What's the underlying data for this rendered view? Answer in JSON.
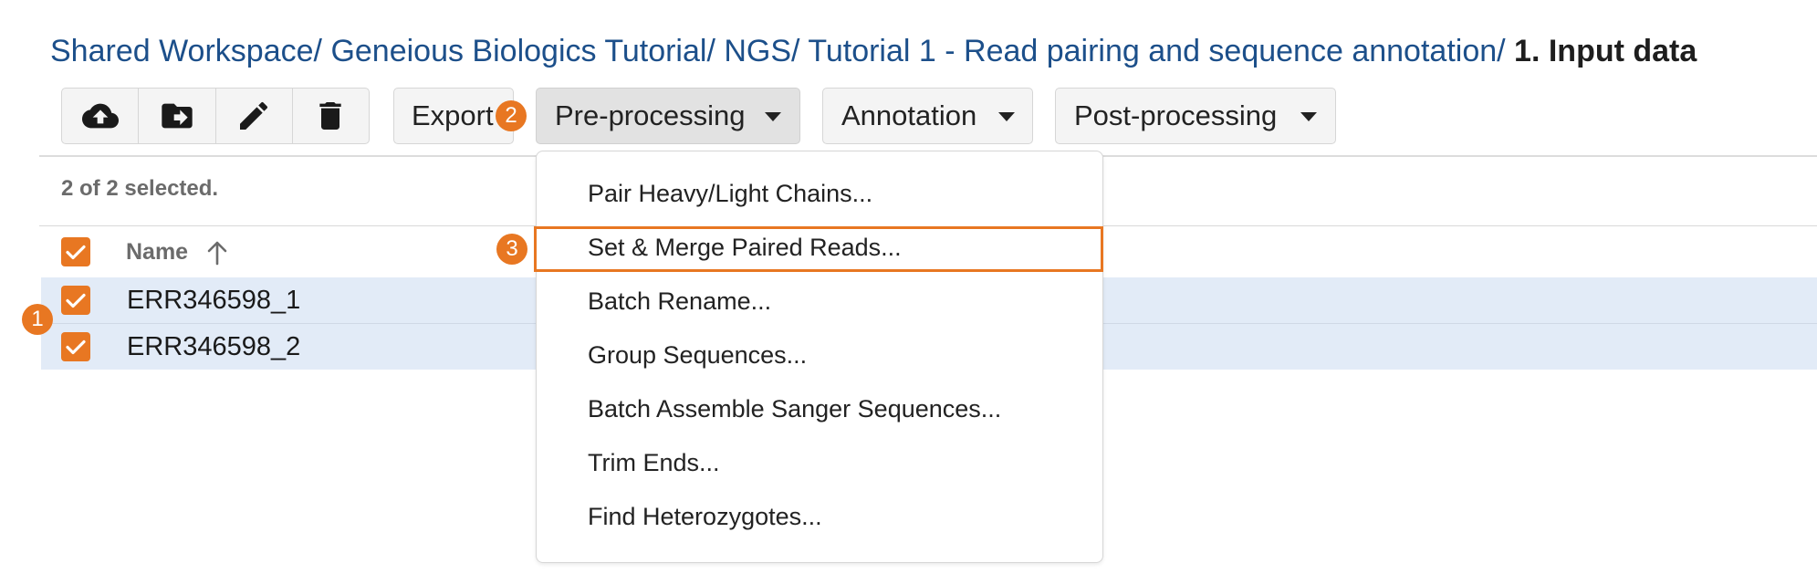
{
  "breadcrumb": {
    "items": [
      "Shared Workspace",
      "Geneious Biologics Tutorial",
      "NGS",
      "Tutorial 1 - Read pairing and sequence annotation"
    ],
    "separator": "/ ",
    "current": "1. Input data"
  },
  "toolbar": {
    "icons": [
      "upload-cloud-icon",
      "move-to-folder-icon",
      "edit-pencil-icon",
      "delete-trash-icon"
    ],
    "export_label": "Export",
    "preprocessing_label": "Pre-processing",
    "annotation_label": "Annotation",
    "postprocessing_label": "Post-processing"
  },
  "badges": {
    "one": "1",
    "two": "2",
    "three": "3"
  },
  "selection": {
    "text": "2 of 2 selected."
  },
  "table": {
    "columns": [
      "Name"
    ],
    "rows": [
      "ERR346598_1",
      "ERR346598_2"
    ]
  },
  "menu": {
    "items": [
      "Pair Heavy/Light Chains...",
      "Set & Merge Paired Reads...",
      "Batch Rename...",
      "Group Sequences...",
      "Batch Assemble Sanger Sequences...",
      "Trim Ends...",
      "Find Heterozygotes..."
    ],
    "highlighted_index": 1
  },
  "colors": {
    "link": "#1c4f8a",
    "accent": "#e87722",
    "selected_row": "#e2ebf7"
  }
}
